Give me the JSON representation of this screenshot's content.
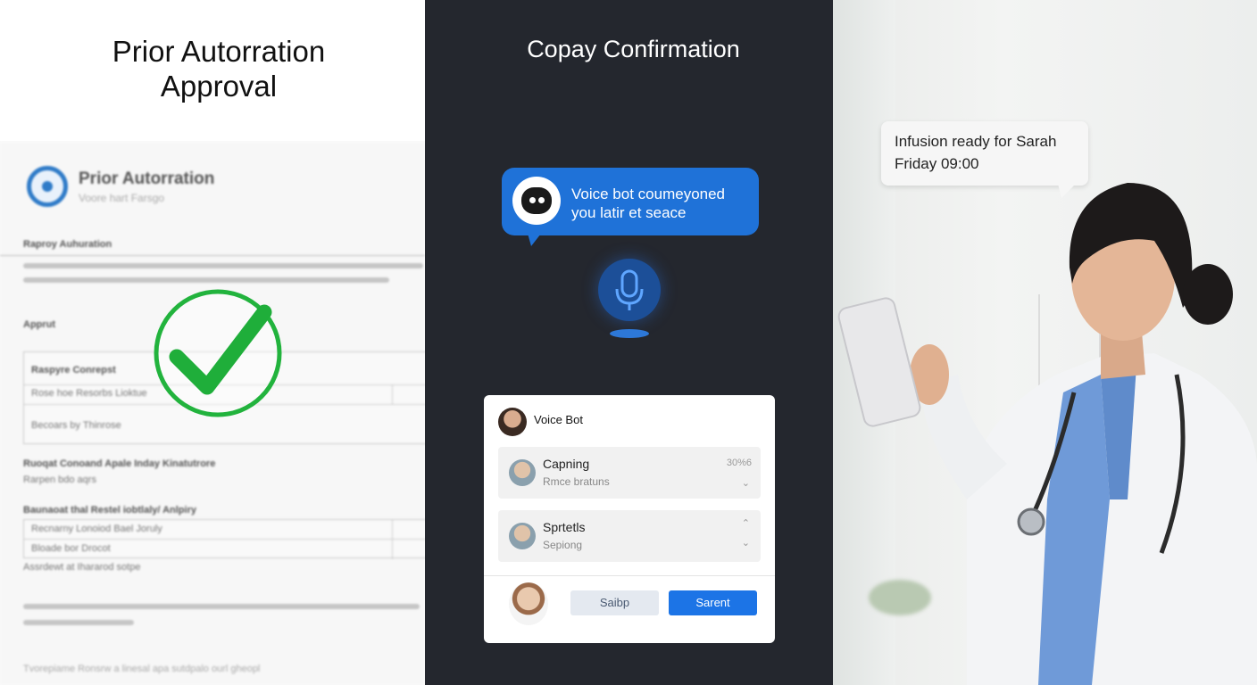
{
  "panel_approval": {
    "title": "Prior Autorration Approval",
    "doc": {
      "title": "Prior Autorration",
      "subtitle": "Voore hart Farsgo",
      "section_1": "Raproy Auhuration",
      "section_2": "Apprut",
      "box_title": "Raspyre Conrepst",
      "box_row_1": "Rose hoe Resorbs Lioktue",
      "box_row_2": "Becoars by Thinrose",
      "section_3": "Ruoqat Conoand Apale Inday Kinatutrore",
      "section_3_sub": "Rarpen bdo aqrs",
      "section_4": "Baunaoat thal Restel iobtlaly/ Anlpiry",
      "table_row_1": "Recnarny Lonoiod Bael Joruly",
      "table_row_2": "Bloade bor Drocot",
      "table_row_3": "Assrdewt at Ihararod sotpe",
      "footer": "Tvorepiame Ronsrw a linesal apa sutdpalo ourl gheopl"
    }
  },
  "panel_copay": {
    "title": "Copay Confirmation",
    "bubble_text": "Voice bot coumeyoned you latir et seace",
    "card": {
      "title": "Voice Bot",
      "rows": [
        {
          "title": "Capning",
          "subtitle": "Rmce bratuns",
          "meta": "30%6"
        },
        {
          "title": "Sprtetls",
          "subtitle": "Sepiong"
        }
      ],
      "skip_label": "Saibp",
      "send_label": "Sarent"
    },
    "colors": {
      "accent": "#1f72d8",
      "background": "#24272e"
    }
  },
  "panel_infusion": {
    "message_line_1": "Infusion ready for Sarah",
    "message_line_2": "Friday 09:00"
  }
}
